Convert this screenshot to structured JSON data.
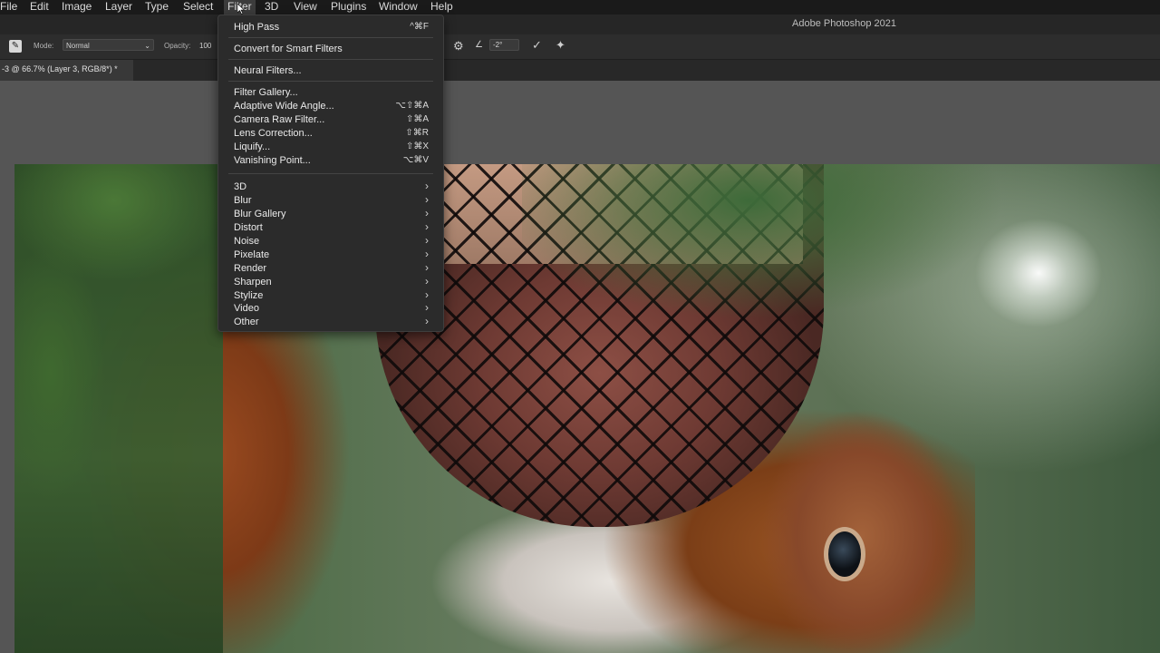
{
  "menubar": {
    "items": [
      "File",
      "Edit",
      "Image",
      "Layer",
      "Type",
      "Select",
      "Filter",
      "3D",
      "View",
      "Plugins",
      "Window",
      "Help"
    ],
    "active": "Filter"
  },
  "app_title": "Adobe Photoshop 2021",
  "options_bar": {
    "mode_label": "Mode:",
    "mode_value": "Normal",
    "opacity_label": "Opacity:",
    "opacity_value": "100",
    "angle_value": "-2°",
    "icons": [
      "brush-preset-icon",
      "gear-icon",
      "angle-icon",
      "pressure-icon",
      "symmetry-icon"
    ]
  },
  "document_tab": {
    "label": "-3 @ 66.7% (Layer 3, RGB/8*) *"
  },
  "filter_menu": {
    "last_filter": {
      "label": "High Pass",
      "shortcut": "^⌘F"
    },
    "convert": "Convert for Smart Filters",
    "neural": "Neural Filters...",
    "group_filters": [
      {
        "label": "Filter Gallery...",
        "shortcut": ""
      },
      {
        "label": "Adaptive Wide Angle...",
        "shortcut": "⌥⇧⌘A"
      },
      {
        "label": "Camera Raw Filter...",
        "shortcut": "⇧⌘A"
      },
      {
        "label": "Lens Correction...",
        "shortcut": "⇧⌘R"
      },
      {
        "label": "Liquify...",
        "shortcut": "⇧⌘X"
      },
      {
        "label": "Vanishing Point...",
        "shortcut": "⌥⌘V"
      }
    ],
    "submenus": [
      "3D",
      "Blur",
      "Blur Gallery",
      "Distort",
      "Noise",
      "Pixelate",
      "Render",
      "Sharpen",
      "Stylize",
      "Video",
      "Other"
    ],
    "submenu_arrow": "›"
  },
  "colors": {
    "menubar_bg": "#1a1a1a",
    "menu_bg": "#2b2b2b",
    "canvas_bg": "#555555"
  }
}
